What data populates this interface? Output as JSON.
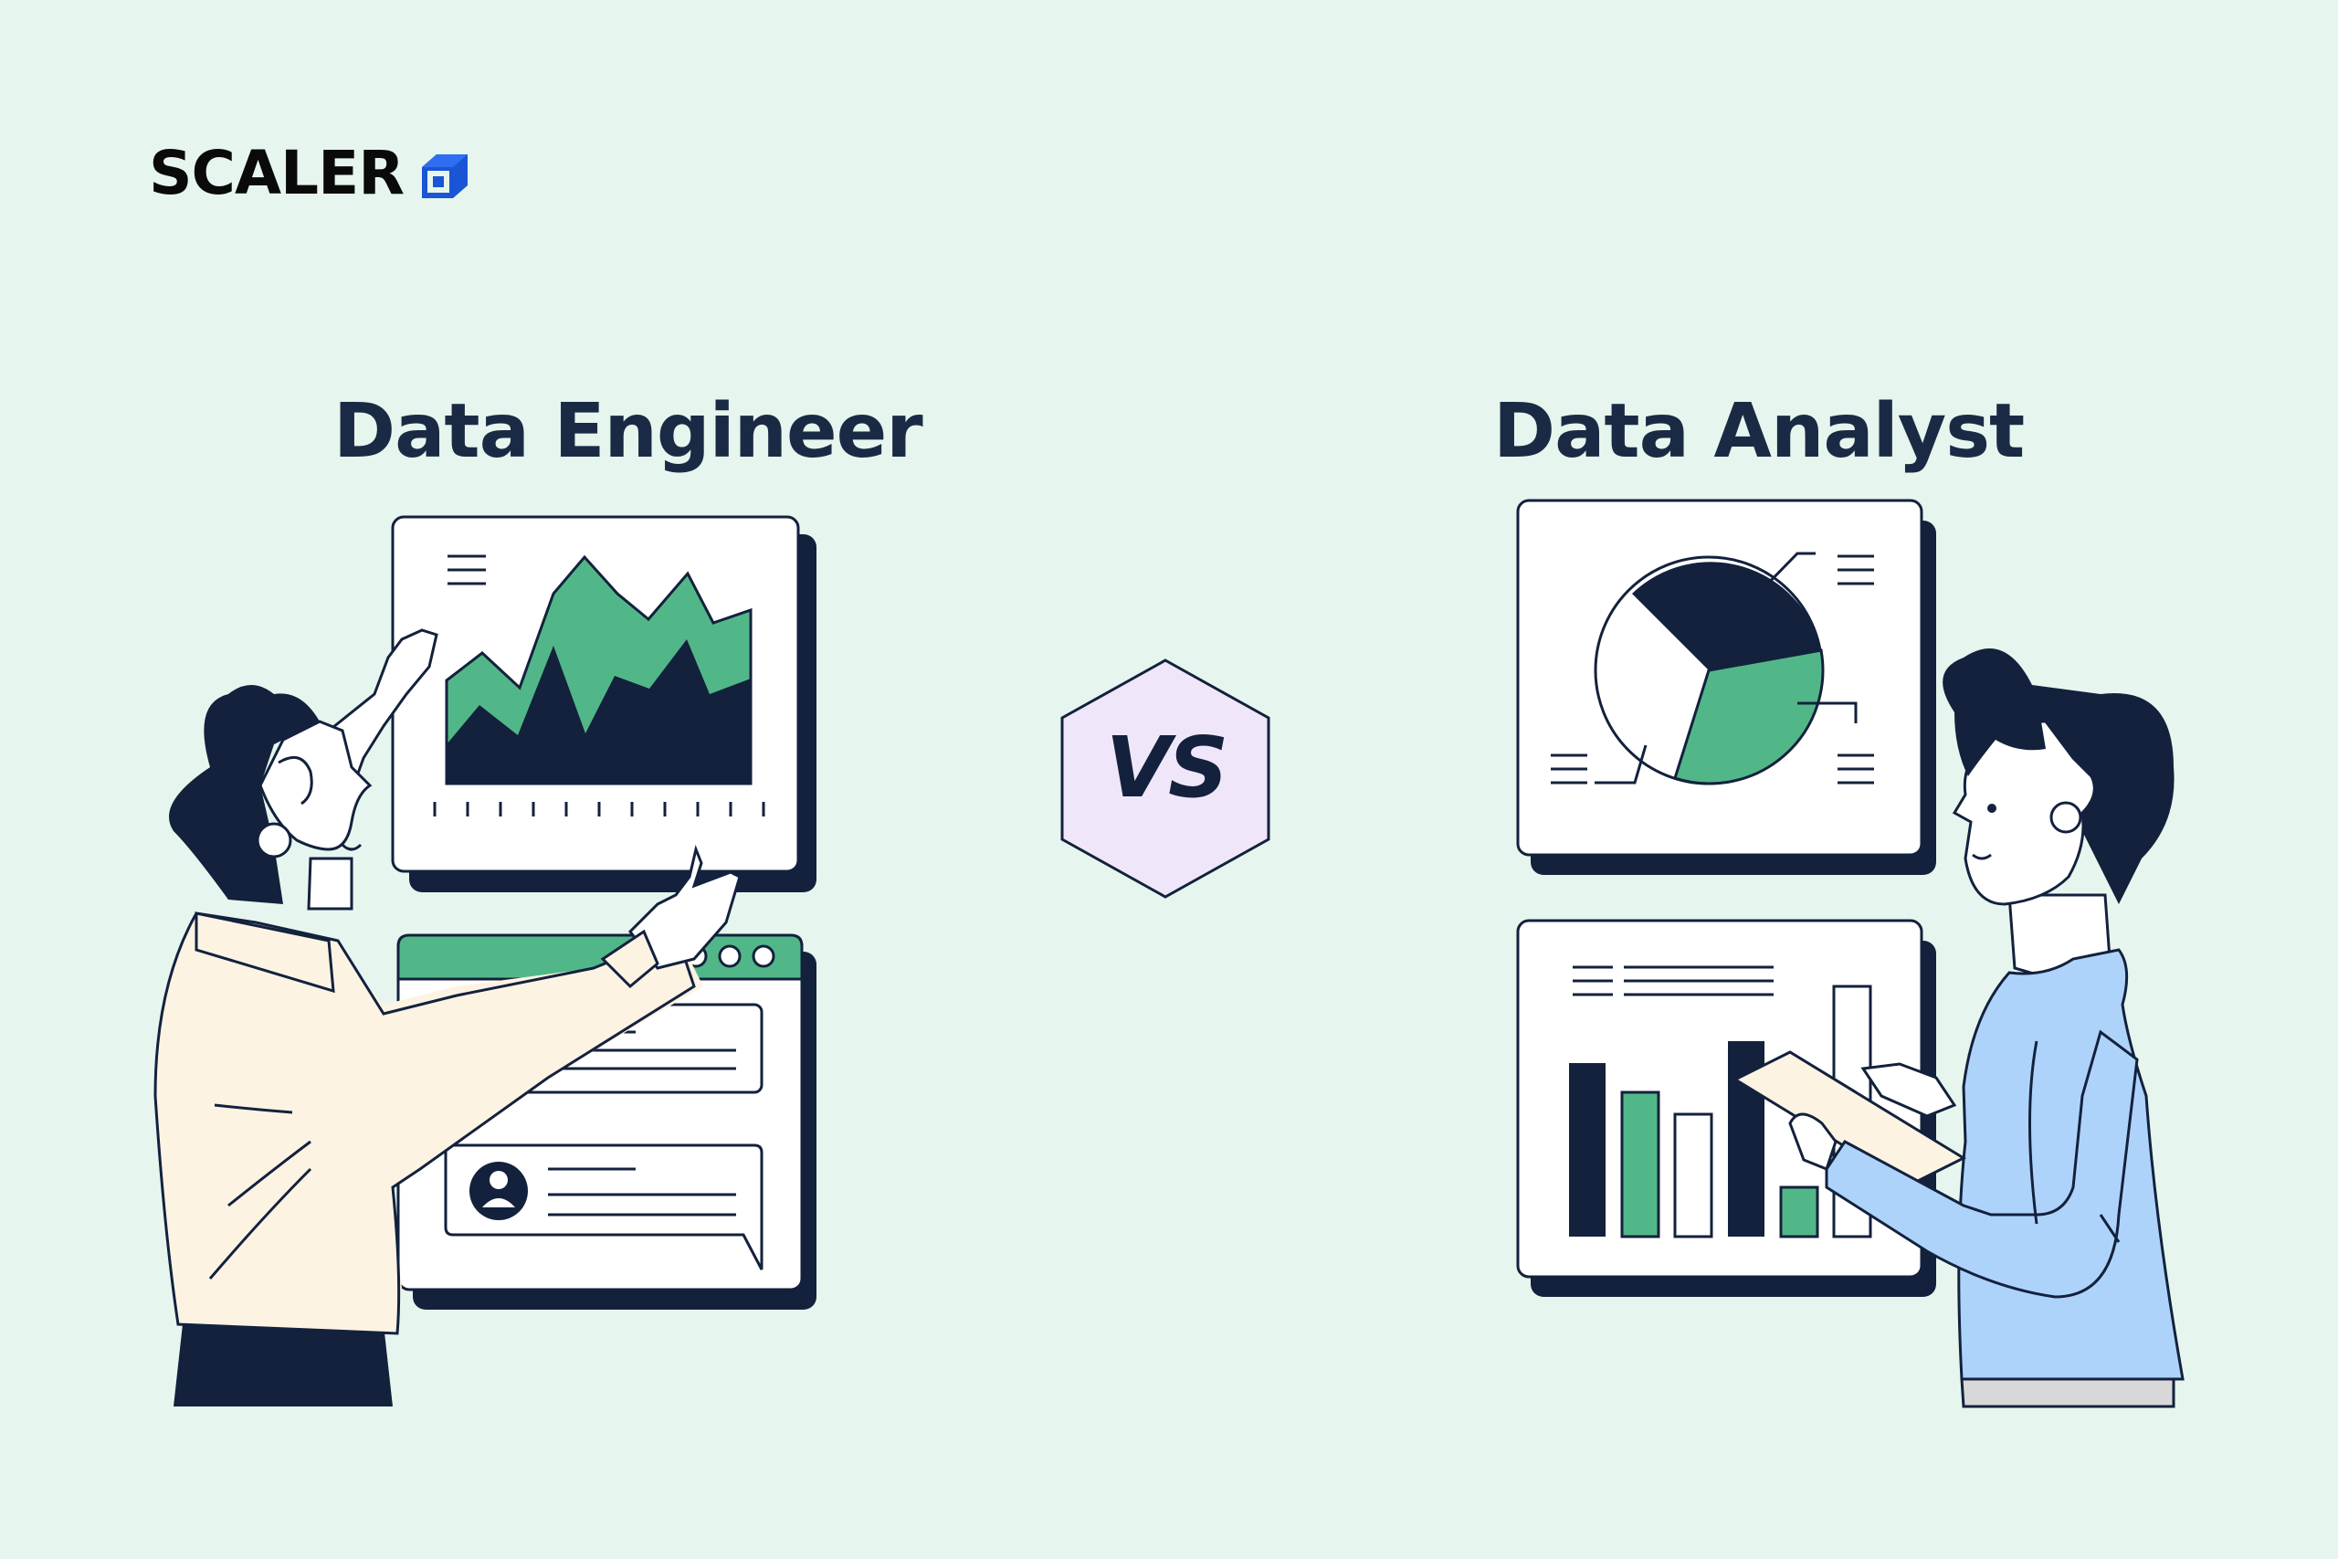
{
  "brand": {
    "name": "SCALER",
    "mark_color": "#1a55d6",
    "mark_icon": "cube-icon"
  },
  "left_panel": {
    "title": "Data Engineer",
    "illustration": "man-presenting-charts"
  },
  "versus": {
    "label": "VS",
    "badge_color": "#f0e6fa"
  },
  "right_panel": {
    "title": "Data Analyst",
    "illustration": "woman-with-tablet-and-charts"
  },
  "colors": {
    "background": "#e6f6ee",
    "navy": "#13213d",
    "green": "#52b788",
    "shirt": "#fdf3e3",
    "blouse": "#aed3fb"
  }
}
